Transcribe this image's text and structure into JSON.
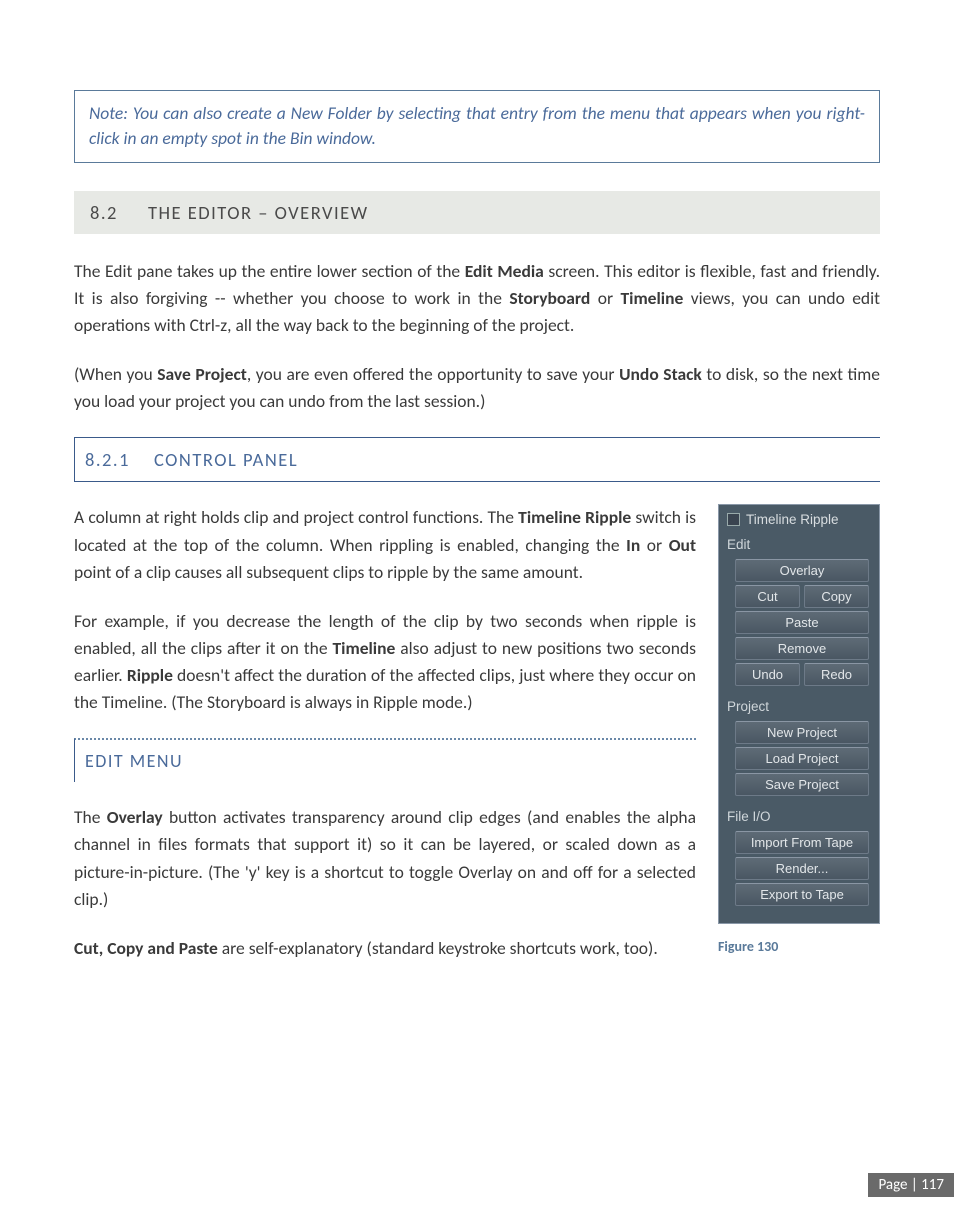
{
  "note": "Note: You can also create a New Folder by selecting that entry from the menu that appears when you right-click in an empty spot in the Bin window.",
  "sec82": {
    "num": "8.2",
    "title": "THE EDITOR – OVERVIEW"
  },
  "para1": {
    "t1": "The Edit pane takes up the entire lower section of the ",
    "b1": "Edit Media",
    "t2": " screen. This editor is flexible, fast and friendly. It is also forgiving -- whether you choose to work in the ",
    "b2": "Storyboard",
    "t3": " or ",
    "b3": "Timeline",
    "t4": " views, you can undo edit operations with Ctrl-z, all the way back to the beginning of the project."
  },
  "para2": {
    "t1": "(When you ",
    "b1": "Save Project",
    "t2": ", you are even offered the opportunity to save your ",
    "b2": "Undo Stack",
    "t3": " to disk, so the next time you load your project you can undo from the last session.)"
  },
  "sec821": {
    "num": "8.2.1",
    "title": "CONTROL PANEL"
  },
  "para3": {
    "t1": "A column at right holds clip and project control functions. The ",
    "b1": "Timeline Ripple",
    "t2": " switch is located at the top of the column. When rippling is enabled, changing the ",
    "b2": "In",
    "t3": " or ",
    "b3": "Out",
    "t4": " point of a clip causes all subsequent clips to ripple by the same amount."
  },
  "para4": {
    "t1": "For example, if you decrease the length of the clip by two seconds when ripple is enabled, all the clips after it on the ",
    "b1": "Timeline",
    "t2": " also adjust to new positions two seconds earlier.  ",
    "b2": "Ripple",
    "t3": " doesn't affect the duration of the affected clips, just where they occur on the Timeline. (The Storyboard is always in Ripple mode.)"
  },
  "editmenu": "EDIT MENU",
  "para5": {
    "t1": "The ",
    "b1": "Overlay",
    "t2": " button activates transparency around clip edges (and enables the alpha channel in files formats that support it) so it can be layered, or scaled down as a picture-in-picture. (The 'y' key is a shortcut to toggle Overlay on and off for a selected clip.)"
  },
  "para6": {
    "b1": "Cut, Copy and Paste",
    "t1": " are self-explanatory (standard keystroke shortcuts work, too)."
  },
  "panel": {
    "ripple": "Timeline Ripple",
    "edit": "Edit",
    "overlay": "Overlay",
    "cut": "Cut",
    "copy": "Copy",
    "paste": "Paste",
    "remove": "Remove",
    "undo": "Undo",
    "redo": "Redo",
    "project": "Project",
    "newproject": "New Project",
    "loadproject": "Load Project",
    "saveproject": "Save Project",
    "fileio": "File I/O",
    "import": "Import From Tape",
    "render": "Render...",
    "export": "Export to Tape"
  },
  "figure": "Figure 130",
  "footer": "Page | 117"
}
